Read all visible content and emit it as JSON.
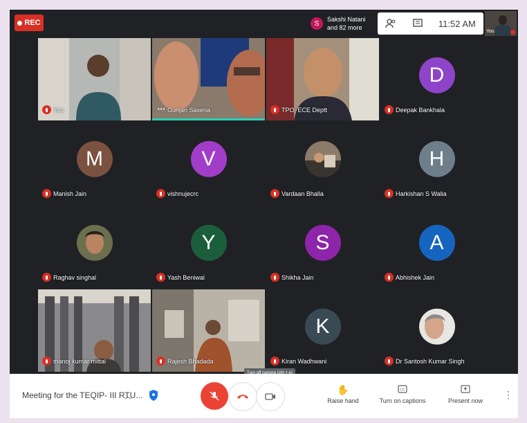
{
  "top_bar": {
    "rec_label": "REC",
    "participant_initial": "S",
    "participant_name": "Sakshi Natani",
    "participant_more": "and 82 more",
    "time": "11:52 AM",
    "self_label": "You"
  },
  "grid": {
    "tiles": [
      {
        "name": "You",
        "type": "video"
      },
      {
        "name": "Gunjan Saxena",
        "type": "video",
        "speaking": true
      },
      {
        "name": "TPO, ECE Deptt",
        "type": "video"
      },
      {
        "name": "Deepak Bankhala",
        "initial": "D",
        "color": "#8e44c9"
      },
      {
        "name": "Manish Jain",
        "initial": "M",
        "color": "#7b5140"
      },
      {
        "name": "vishnujecrc",
        "initial": "V",
        "color": "#a23dc9"
      },
      {
        "name": "Vardaan Bhalla",
        "type": "photo"
      },
      {
        "name": "Harkishan S Walia",
        "initial": "H",
        "color": "#6e7e8b"
      },
      {
        "name": "Raghav singhal",
        "type": "photo"
      },
      {
        "name": "Yash Beniwal",
        "initial": "Y",
        "color": "#1b5e3c"
      },
      {
        "name": "Shikha Jain",
        "initial": "S",
        "color": "#8e24aa"
      },
      {
        "name": "Abhishek Jain",
        "initial": "A",
        "color": "#1565c0"
      },
      {
        "name": "manoj kumar mittal",
        "type": "video"
      },
      {
        "name": "Rajesh Bhadada",
        "type": "video"
      },
      {
        "name": "Kiran Wadhwani",
        "initial": "K",
        "color": "#3a4a55"
      },
      {
        "name": "Dr Santosh Kumar Singh",
        "type": "photo"
      }
    ]
  },
  "tooltip": "Turn off camera (ctrl + e)",
  "bottom_bar": {
    "meeting_title": "Meeting for the TEQIP- III RTU...",
    "raise_hand": "Raise hand",
    "captions": "Turn on captions",
    "present": "Present now"
  },
  "colors": {
    "background": "#202124",
    "record_red": "#d93025",
    "speaking_teal": "#2ad1b4",
    "mic_button": "#ea4335"
  }
}
